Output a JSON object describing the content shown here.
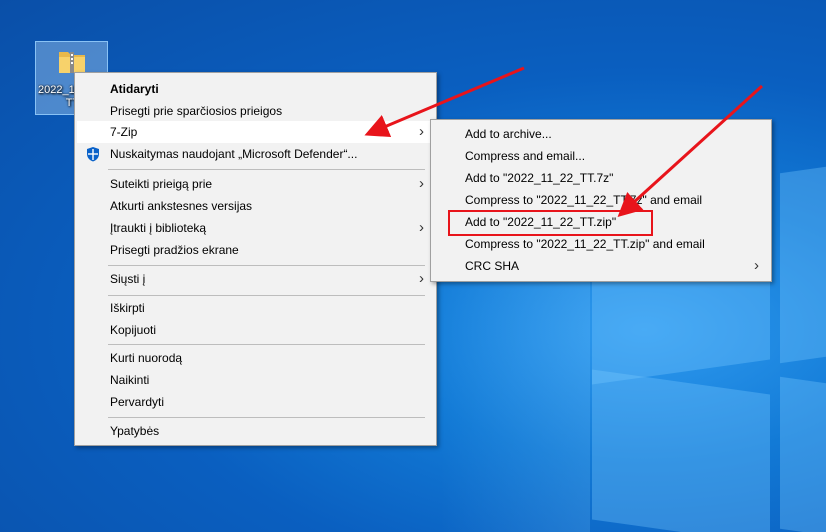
{
  "desktop": {
    "icon_label_line1": "2022_11_22_TT",
    "icon_label_line2": "TT",
    "icon_name": "folder-zip-icon"
  },
  "context_menu": {
    "items": [
      {
        "label": "Atidaryti"
      },
      {
        "label": "Prisegti prie sparčiosios prieigos"
      },
      {
        "label": "7-Zip"
      },
      {
        "label": "Nuskaitymas naudojant „Microsoft Defender“..."
      },
      {
        "label": "Suteikti prieigą prie"
      },
      {
        "label": "Atkurti ankstesnes versijas"
      },
      {
        "label": "Įtraukti į biblioteką"
      },
      {
        "label": "Prisegti pradžios ekrane"
      },
      {
        "label": "Siųsti į"
      },
      {
        "label": "Iškirpti"
      },
      {
        "label": "Kopijuoti"
      },
      {
        "label": "Kurti nuorodą"
      },
      {
        "label": "Naikinti"
      },
      {
        "label": "Pervardyti"
      },
      {
        "label": "Ypatybės"
      }
    ]
  },
  "submenu_7zip": {
    "items": [
      {
        "label": "Add to archive..."
      },
      {
        "label": "Compress and email..."
      },
      {
        "label": "Add to \"2022_11_22_TT.7z\""
      },
      {
        "label": "Compress to \"2022_11_22_TT.7z\" and email"
      },
      {
        "label": "Add to \"2022_11_22_TT.zip\""
      },
      {
        "label": "Compress to \"2022_11_22_TT.zip\" and email"
      },
      {
        "label": "CRC SHA"
      }
    ]
  },
  "annotation": {
    "color": "#e8141b",
    "highlighted_item": "Add to \"2022_11_22_TT.zip\""
  }
}
